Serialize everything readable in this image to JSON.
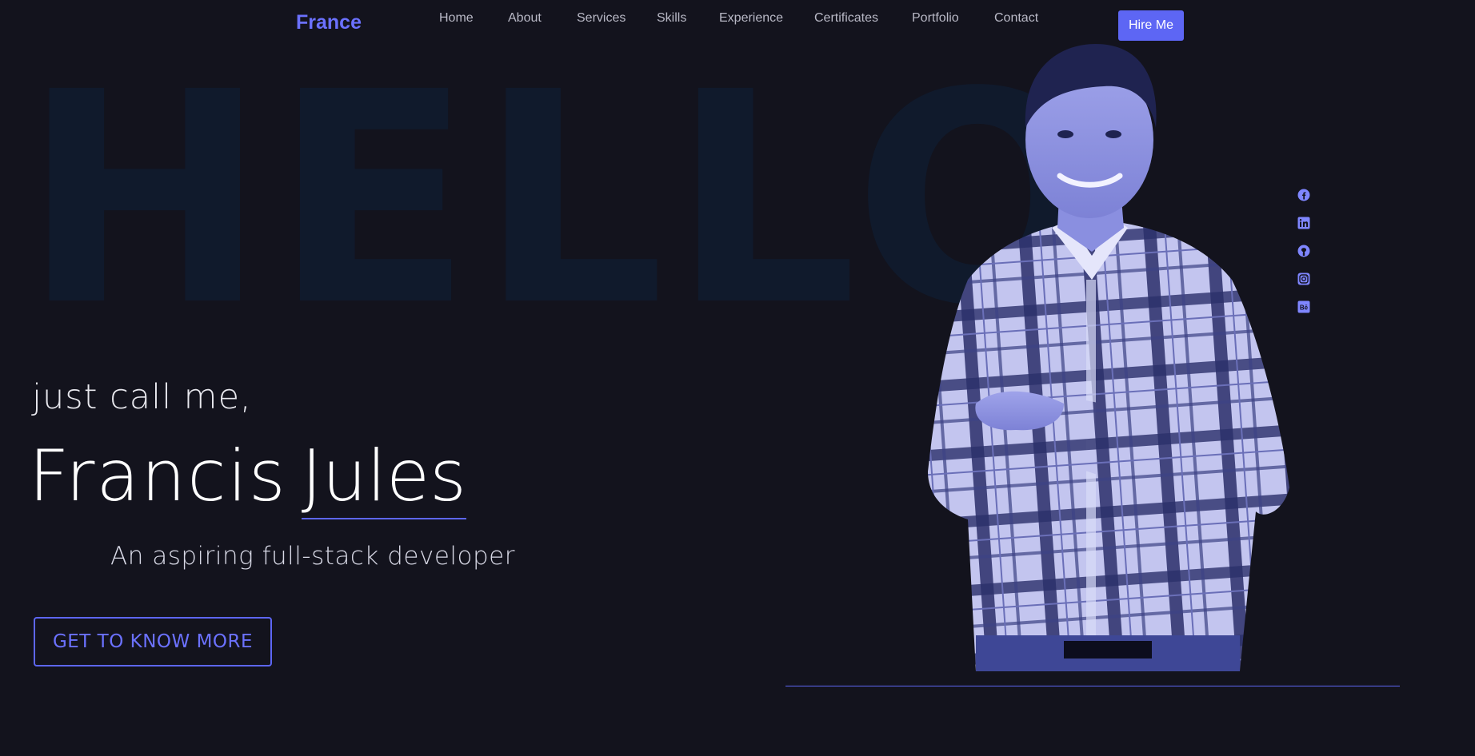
{
  "brand": "France",
  "nav": [
    "Home",
    "About",
    "Services",
    "Skills",
    "Experience",
    "Certificates",
    "Portfolio",
    "Contact"
  ],
  "hire_label": "Hire Me",
  "background_word": "HELLO",
  "hero": {
    "intro": "just call me,",
    "first_name": "Francis",
    "last_name": "Jules",
    "tagline": "An aspiring full-stack developer",
    "cta": "GET TO KNOW MORE"
  },
  "socials": [
    "facebook-icon",
    "linkedin-icon",
    "github-icon",
    "instagram-icon",
    "behance-icon"
  ],
  "colors": {
    "accent": "#5d66f4",
    "brand": "#6b71ff",
    "background": "#13131d",
    "hello": "#101a2c"
  }
}
